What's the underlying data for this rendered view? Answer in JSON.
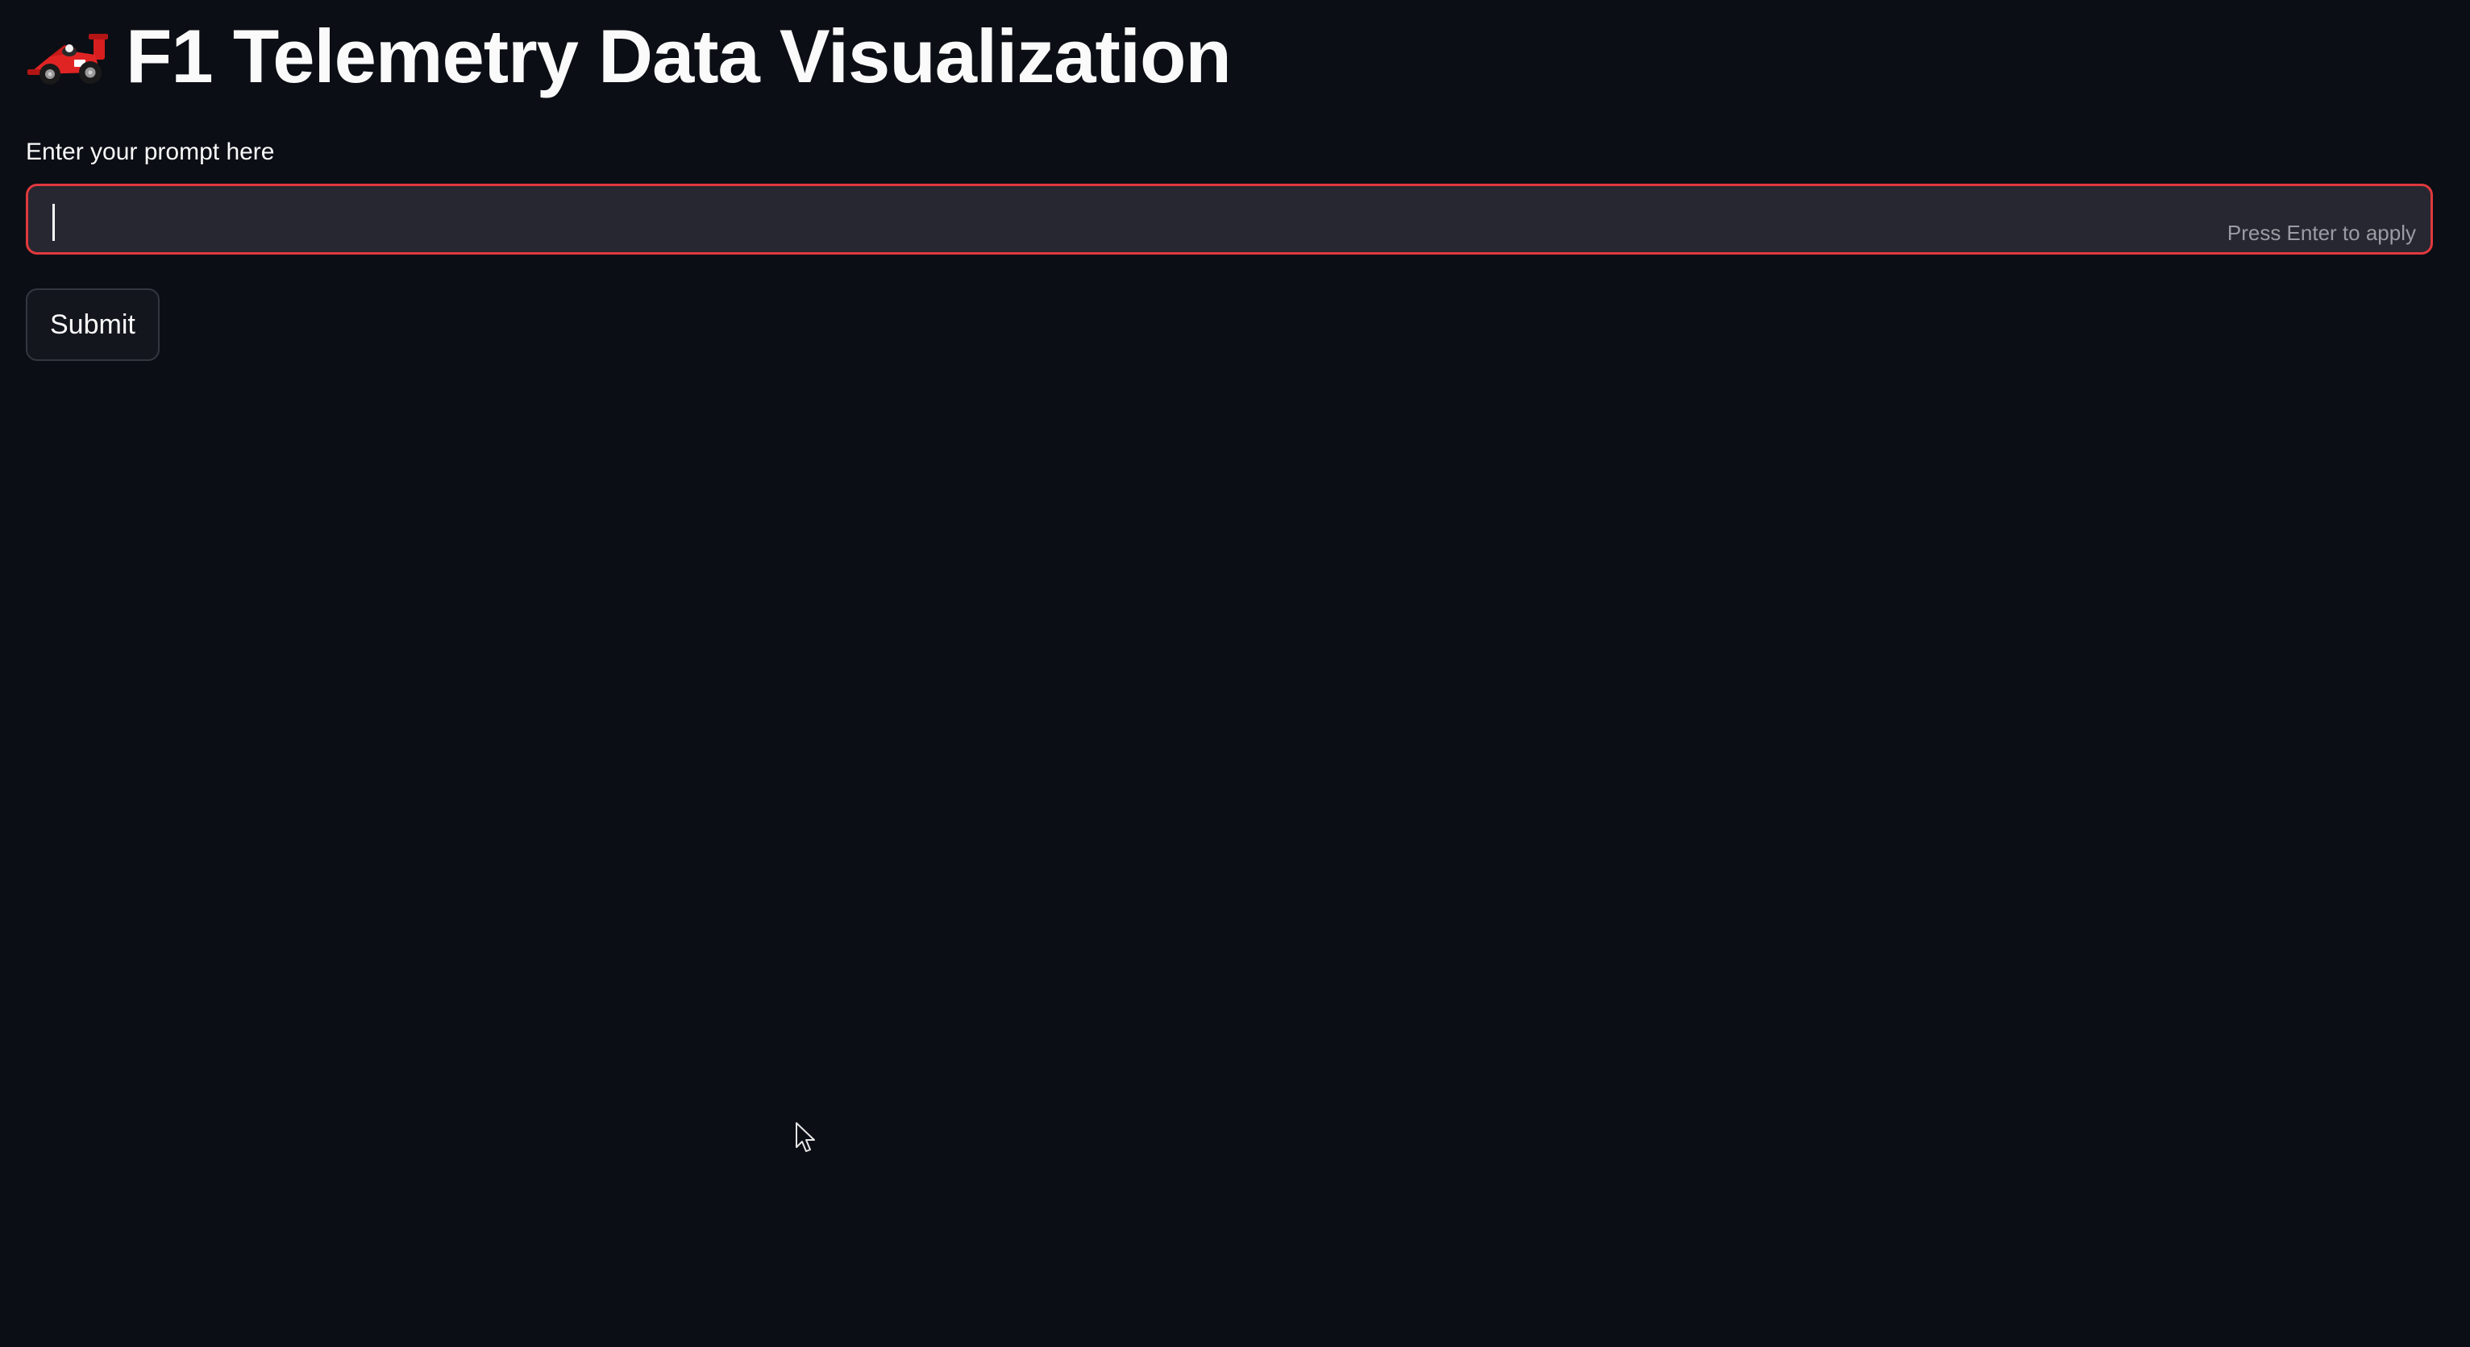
{
  "header": {
    "title": "F1 Telemetry Data Visualization",
    "icon": "race-car-icon"
  },
  "prompt": {
    "label": "Enter your prompt here",
    "value": "",
    "placeholder": "",
    "hint": "Press Enter to apply",
    "border_color": "#e0393e"
  },
  "actions": {
    "submit_label": "Submit"
  },
  "theme": {
    "background": "#0b0e14",
    "input_background": "#262730",
    "text": "#fafafa",
    "accent": "#e0393e"
  }
}
